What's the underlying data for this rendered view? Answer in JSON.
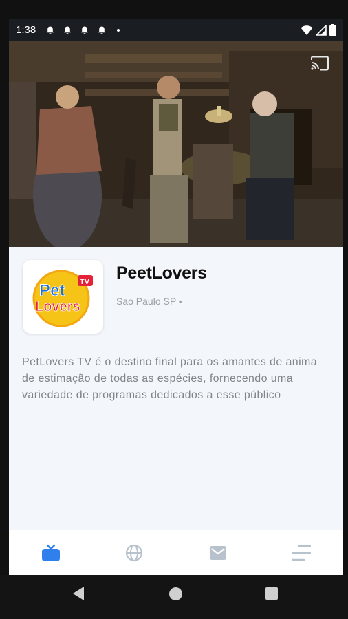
{
  "status_bar": {
    "time": "1:38"
  },
  "channel": {
    "name": "PeetLovers",
    "location": "Sao Paulo SP •",
    "logo_text_top": "Pet",
    "logo_text_bottom": "Lovers",
    "logo_badge": "TV",
    "description": "PetLovers TV é o destino final para os amantes de anima\nde estimação de todas as espécies, fornecendo uma\nvariedade de programas dedicados a esse público"
  },
  "bottom_nav": [
    {
      "icon": "tv-icon",
      "active": true
    },
    {
      "icon": "globe-icon",
      "active": false
    },
    {
      "icon": "mail-icon",
      "active": false
    },
    {
      "icon": "menu-lines-icon",
      "active": false
    }
  ],
  "colors": {
    "accent": "#2f80ed",
    "inactive": "#b8c2cc",
    "background": "#f3f6fa"
  }
}
